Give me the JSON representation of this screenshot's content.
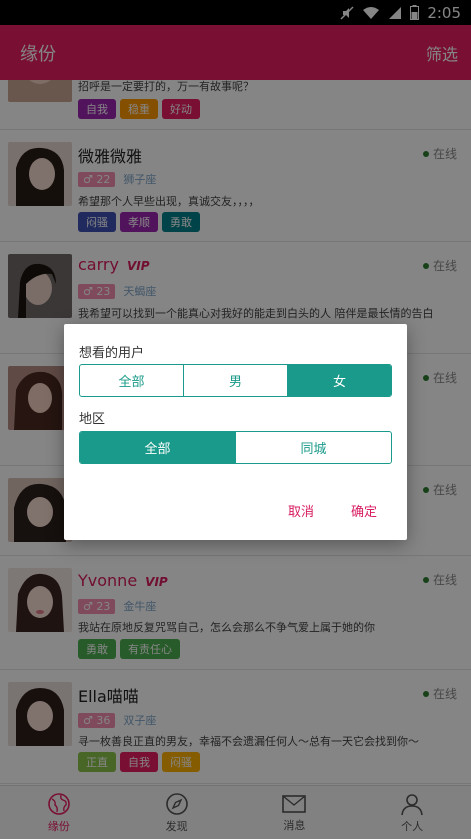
{
  "statusbar": {
    "time": "2:05"
  },
  "appbar": {
    "title": "缘份",
    "filter_label": "筛选"
  },
  "colors": {
    "accent": "#e91e63",
    "teal": "#1a9a8a",
    "vip": "#d81b60"
  },
  "profiles": [
    {
      "name": "",
      "vip": false,
      "online": "",
      "age": "",
      "zodiac": "",
      "signature": "招呼是一定要打的，万一有故事呢？",
      "tags": [
        {
          "label": "自我",
          "color": "#9c27b0"
        },
        {
          "label": "稳重",
          "color": "#ff9800"
        },
        {
          "label": "好动",
          "color": "#e91e63"
        }
      ]
    },
    {
      "name": "微雅微雅",
      "vip": false,
      "online": "在线",
      "age": "22",
      "zodiac": "狮子座",
      "signature": "希望那个人早些出现，真诚交友，，，，",
      "tags": [
        {
          "label": "闷骚",
          "color": "#3f51b5"
        },
        {
          "label": "孝顺",
          "color": "#9c27b0"
        },
        {
          "label": "勇敢",
          "color": "#00838f"
        }
      ]
    },
    {
      "name": "carry",
      "vip": true,
      "online": "在线",
      "age": "23",
      "zodiac": "天蝎座",
      "signature": "我希望可以找到一个能真心对我好的能走到白头的人 陪伴是最长情的告白",
      "tags": []
    },
    {
      "name": "",
      "vip": false,
      "online": "在线",
      "age": "",
      "zodiac": "",
      "signature": "",
      "tags": []
    },
    {
      "name": "",
      "vip": false,
      "online": "在线",
      "age": "",
      "zodiac": "",
      "signature": "",
      "tags": []
    },
    {
      "name": "Yvonne",
      "vip": true,
      "online": "在线",
      "age": "23",
      "zodiac": "金牛座",
      "signature": "我站在原地反复咒骂自己，怎么会那么不争气爱上属于她的你",
      "tags": [
        {
          "label": "勇敢",
          "color": "#4caf50"
        },
        {
          "label": "有责任心",
          "color": "#4caf50"
        }
      ]
    },
    {
      "name": "Ella喵喵",
      "vip": false,
      "online": "在线",
      "age": "36",
      "zodiac": "双子座",
      "signature": "寻一枚善良正直的男友，幸福不会遗漏任何人～总有一天它会找到你～",
      "tags": [
        {
          "label": "正直",
          "color": "#8bc34a"
        },
        {
          "label": "自我",
          "color": "#e91e63"
        },
        {
          "label": "闷骚",
          "color": "#ffb300"
        }
      ]
    }
  ],
  "vip_label": "VIP",
  "dialog": {
    "user_label": "想看的用户",
    "gender_options": [
      "全部",
      "男",
      "女"
    ],
    "gender_selected": "女",
    "region_label": "地区",
    "region_options": [
      "全部",
      "同城"
    ],
    "region_selected": "全部",
    "cancel_label": "取消",
    "confirm_label": "确定"
  },
  "bottom_nav": [
    {
      "label": "缘份",
      "icon": "globe-icon",
      "active": true
    },
    {
      "label": "发现",
      "icon": "compass-icon",
      "active": false
    },
    {
      "label": "消息",
      "icon": "mail-icon",
      "active": false
    },
    {
      "label": "个人",
      "icon": "person-icon",
      "active": false
    }
  ]
}
